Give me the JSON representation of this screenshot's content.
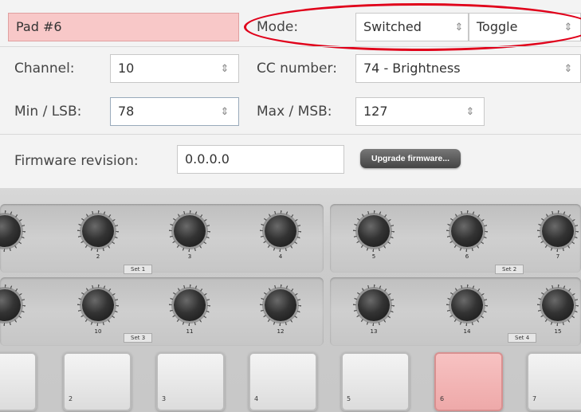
{
  "pad": {
    "name": "Pad #6"
  },
  "mode": {
    "label": "Mode:",
    "value1": "Switched",
    "value2": "Toggle",
    "highlight_color": "#e0001a"
  },
  "channel": {
    "label": "Channel:",
    "value": "10"
  },
  "cc": {
    "label": "CC number:",
    "value": "74 - Brightness"
  },
  "min": {
    "label": "Min / LSB:",
    "value": "78"
  },
  "max": {
    "label": "Max / MSB:",
    "value": "127"
  },
  "firmware": {
    "label": "Firmware revision:",
    "value": "0.0.0.0",
    "button": "Upgrade firmware..."
  },
  "knobs": {
    "row1": {
      "labels": [
        "2",
        "3",
        "4",
        "5",
        "6",
        "7"
      ],
      "set_left": "Set 1",
      "set_right": "Set 2"
    },
    "row2": {
      "labels": [
        "10",
        "11",
        "12",
        "13",
        "14",
        "15"
      ],
      "set_left": "Set 3",
      "set_right": "Set 4"
    }
  },
  "pads": {
    "labels": [
      "2",
      "3",
      "4",
      "5",
      "6",
      "7"
    ],
    "active_color": "#f2b6b6"
  }
}
